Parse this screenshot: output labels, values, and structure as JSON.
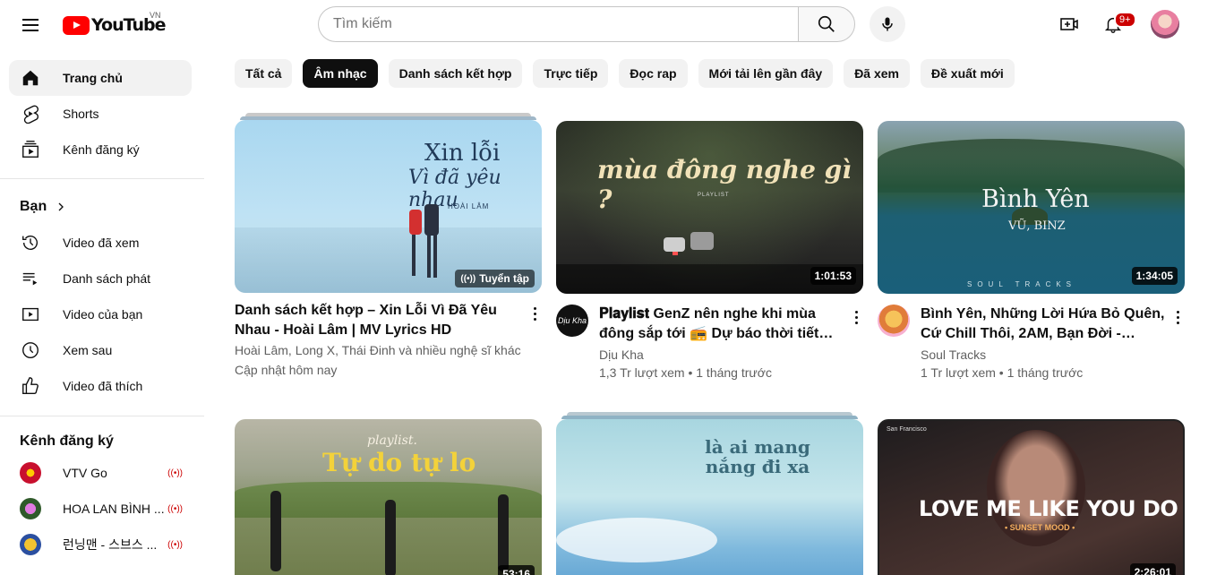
{
  "header": {
    "logo_text": "YouTube",
    "country_code": "VN",
    "search_placeholder": "Tìm kiếm",
    "notification_count": "9+"
  },
  "sidebar": {
    "main": [
      {
        "label": "Trang chủ",
        "icon": "home-icon",
        "active": true
      },
      {
        "label": "Shorts",
        "icon": "shorts-icon"
      },
      {
        "label": "Kênh đăng ký",
        "icon": "subscriptions-icon"
      }
    ],
    "you_title": "Bạn",
    "you_items": [
      {
        "label": "Video đã xem",
        "icon": "history-icon"
      },
      {
        "label": "Danh sách phát",
        "icon": "playlists-icon"
      },
      {
        "label": "Video của bạn",
        "icon": "your-videos-icon"
      },
      {
        "label": "Xem sau",
        "icon": "watch-later-icon"
      },
      {
        "label": "Video đã thích",
        "icon": "liked-icon"
      }
    ],
    "subs_title": "Kênh đăng ký",
    "subscriptions": [
      {
        "label": "VTV Go",
        "live": true
      },
      {
        "label": "HOA LAN BÌNH ...",
        "live": true
      },
      {
        "label": "런닝맨 - 스브스 ...",
        "live": true
      }
    ]
  },
  "chips": [
    "Tất cả",
    "Âm nhạc",
    "Danh sách kết hợp",
    "Trực tiếp",
    "Đọc rap",
    "Mới tải lên gần đây",
    "Đã xem",
    "Đề xuất mới"
  ],
  "selected_chip": "Âm nhạc",
  "videos": [
    {
      "title": "Danh sách kết hợp – Xin Lỗi Vì Đã Yêu Nhau - Hoài Lâm | MV Lyrics HD",
      "channel": "Hoài Lâm, Long X, Thái Đinh và nhiều nghệ sĩ khác",
      "meta": "Cập nhật hôm nay",
      "badge": "Tuyển tập",
      "thumb_title_1": "Xin lỗi",
      "thumb_title_2": "Vì đã yêu nhau",
      "thumb_artist": "HOÀI LÂM"
    },
    {
      "title": "𝐏𝐥𝐚𝐲𝐥𝐢𝐬𝐭 GenZ nên nghe khi mùa đông sắp tới 📻 Dự báo thời tiết mùa đôn…",
      "channel": "Dịu Kha",
      "meta": "1,3 Tr lượt xem • 1 tháng trước",
      "duration": "1:01:53",
      "thumb_title": "mùa đông nghe gì ?",
      "thumb_sub": "PLAYLIST"
    },
    {
      "title": "Bình Yên, Những Lời Hứa Bỏ Quên, Cứ Chill Thôi, 2AM, Bạn Đời - Những Bài…",
      "channel": "Soul Tracks",
      "meta": "1 Tr lượt xem • 1 tháng trước",
      "duration": "1:34:05",
      "thumb_title": "Bình Yên",
      "thumb_artist": "VŨ, BINZ",
      "thumb_footer": "SOUL TRACKS"
    },
    {
      "thumb_label": "playlist.",
      "thumb_title": "Tự do tự lo",
      "duration": "53:16"
    },
    {
      "thumb_title": "là ai mang nắng đi xa"
    },
    {
      "thumb_title": "LOVE ME LIKE YOU DO",
      "thumb_sub": "• SUNSET MOOD •",
      "thumb_top": "San Francisco",
      "duration": "2:26:01"
    }
  ],
  "colors": {
    "brand_red": "#ff0000",
    "chip_bg": "#f2f2f2",
    "chip_selected": "#0f0f0f",
    "live": "#cc0000"
  }
}
